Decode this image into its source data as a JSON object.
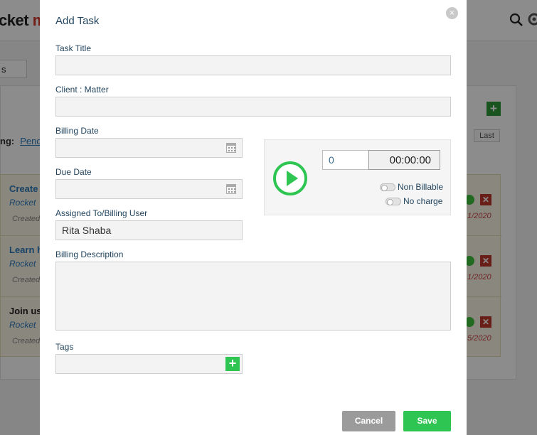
{
  "background": {
    "logo_text": "cket",
    "logo_suffix": "m",
    "tab_label": "s",
    "filter_label": "ng:",
    "filter_value": "Pend",
    "pager_last": "Last",
    "rows": [
      {
        "title": "Create",
        "subtitle": "Rocket",
        "created": "Created",
        "date": "1/2020"
      },
      {
        "title": "Learn h",
        "subtitle": "Rocket",
        "created": "Created",
        "date": "1/2020"
      },
      {
        "title": "Join us",
        "subtitle": "Rocket",
        "created": "Created",
        "date": "5/2020"
      }
    ]
  },
  "modal": {
    "title": "Add Task",
    "close_icon": "×",
    "fields": {
      "task_title": {
        "label": "Task Title",
        "value": ""
      },
      "client_matter": {
        "label": "Client : Matter",
        "value": ""
      },
      "billing_date": {
        "label": "Billing Date",
        "value": ""
      },
      "due_date": {
        "label": "Due Date",
        "value": ""
      },
      "assigned_to": {
        "label": "Assigned To/Billing User",
        "value": "Rita Shaba"
      },
      "billing_description": {
        "label": "Billing Description",
        "value": ""
      },
      "tags": {
        "label": "Tags",
        "value": ""
      }
    },
    "timer": {
      "hours_value": "0",
      "clock_value": "00:00:00",
      "non_billable_label": "Non Billable",
      "no_charge_label": "No charge"
    },
    "buttons": {
      "cancel": "Cancel",
      "save": "Save",
      "tags_add": "+"
    }
  },
  "colors": {
    "accent_green": "#2ec553",
    "label_color": "#23455e",
    "cancel_gray": "#9b9b9b"
  }
}
